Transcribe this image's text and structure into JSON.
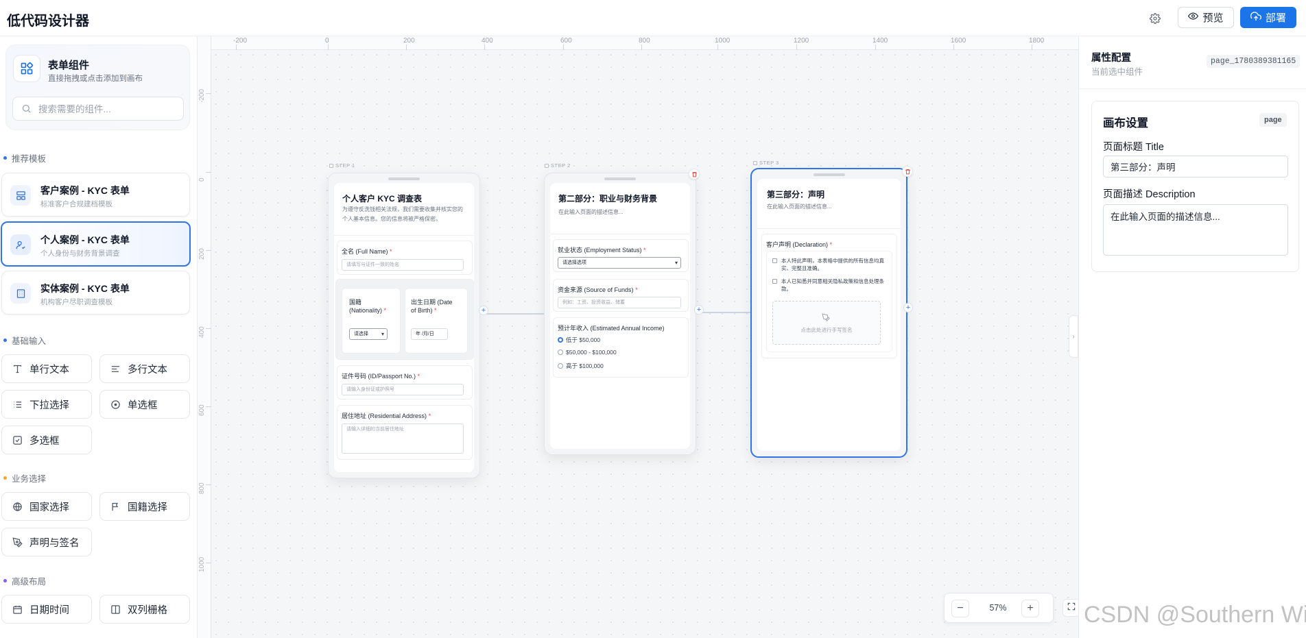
{
  "app": {
    "title": "低代码设计器"
  },
  "header": {
    "preview_label": "预览",
    "deploy_label": "部署"
  },
  "sidebar": {
    "component_card": {
      "title": "表单组件",
      "subtitle": "直接拖拽或点击添加到画布"
    },
    "search": {
      "placeholder": "搜索需要的组件..."
    },
    "sections": {
      "templates": {
        "label": "推荐模板",
        "color": "#2f75e8"
      },
      "basic": {
        "label": "基础输入",
        "color": "#2f75e8"
      },
      "business": {
        "label": "业务选择",
        "color": "#f5a623"
      },
      "layout": {
        "label": "高级布局",
        "color": "#8b5cf6"
      }
    },
    "templates": [
      {
        "title": "客户案例 - KYC 表单",
        "subtitle": "标准客户合规建档模板",
        "icon": "layout-icon"
      },
      {
        "title": "个人案例 - KYC 表单",
        "subtitle": "个人身份与财务背景调查",
        "icon": "user-check-icon"
      },
      {
        "title": "实体案例 - KYC 表单",
        "subtitle": "机构客户尽职调查模板",
        "icon": "building-icon"
      }
    ],
    "basic_widgets": [
      {
        "label": "单行文本",
        "icon": "text-icon"
      },
      {
        "label": "多行文本",
        "icon": "align-left-icon"
      },
      {
        "label": "下拉选择",
        "icon": "list-icon"
      },
      {
        "label": "单选框",
        "icon": "radio-icon"
      },
      {
        "label": "多选框",
        "icon": "checkbox-icon"
      }
    ],
    "business_widgets": [
      {
        "label": "国家选择",
        "icon": "globe-icon"
      },
      {
        "label": "国籍选择",
        "icon": "flag-icon"
      },
      {
        "label": "声明与签名",
        "icon": "pen-icon"
      }
    ],
    "layout_widgets": [
      {
        "label": "日期时间",
        "icon": "calendar-icon"
      },
      {
        "label": "双列栅格",
        "icon": "columns-icon"
      }
    ]
  },
  "canvas": {
    "ruler_x": [
      "-200",
      "0",
      "200",
      "400",
      "600",
      "800",
      "1000",
      "1200",
      "1400",
      "1600",
      "1800"
    ],
    "ruler_y": [
      "-200",
      "0",
      "200",
      "400",
      "600",
      "800",
      "1000"
    ],
    "zoom": "57%",
    "steps": [
      {
        "label": "STEP 1",
        "title": "个人客户 KYC 调查表",
        "description": "为遵守反洗钱相关法规，我们需要收集并核实您的个人基本信息。您的信息将被严格保密。",
        "fields": {
          "full_name": {
            "label": "全名 (Full Name)",
            "placeholder": "请填写与证件一致的姓名"
          },
          "nationality": {
            "label": "国籍 (Nationality)",
            "value": "请选择"
          },
          "dob": {
            "label": "出生日期 (Date of Birth)",
            "value": "年 /月/日"
          },
          "id_no": {
            "label": "证件号码 (ID/Passport No.)",
            "placeholder": "请输入身份证或护照号"
          },
          "address": {
            "label": "居住地址 (Residential Address)",
            "placeholder": "请输入详细的当前居住地址"
          }
        }
      },
      {
        "label": "STEP 2",
        "title": "第二部分：职业与财务背景",
        "description": "在此输入页面的描述信息...",
        "fields": {
          "employment": {
            "label": "就业状态 (Employment Status)",
            "value": "请选择选项"
          },
          "source": {
            "label": "资金来源 (Source of Funds)",
            "placeholder": "例如：工资、投资收益、储蓄"
          },
          "income": {
            "label": "预计年收入 (Estimated Annual Income)",
            "options": [
              "低于 $50,000",
              "$50,000 - $100,000",
              "高于 $100,000"
            ],
            "selected_index": 0
          }
        }
      },
      {
        "label": "STEP 3",
        "title": "第三部分：声明",
        "description": "在此输入页面的描述信息...",
        "fields": {
          "declaration": {
            "label": "客户声明 (Declaration)",
            "items": [
              "本人特此声明，本表格中提供的所有信息均真实、完整且准确。",
              "本人已知悉并同意相关隐私政策和信息处理条款。"
            ],
            "signature_hint": "点击此处进行手写签名"
          }
        }
      }
    ]
  },
  "properties": {
    "title": "属性配置",
    "subtitle": "当前选中组件",
    "selected_id": "page_1780389381165",
    "card": {
      "title": "画布设置",
      "badge": "page",
      "page_title_label": "页面标题 Title",
      "page_title_value": "第三部分：声明",
      "page_desc_label": "页面描述 Description",
      "page_desc_value": "在此输入页面的描述信息..."
    }
  },
  "watermark": "CSDN @Southern Wind"
}
